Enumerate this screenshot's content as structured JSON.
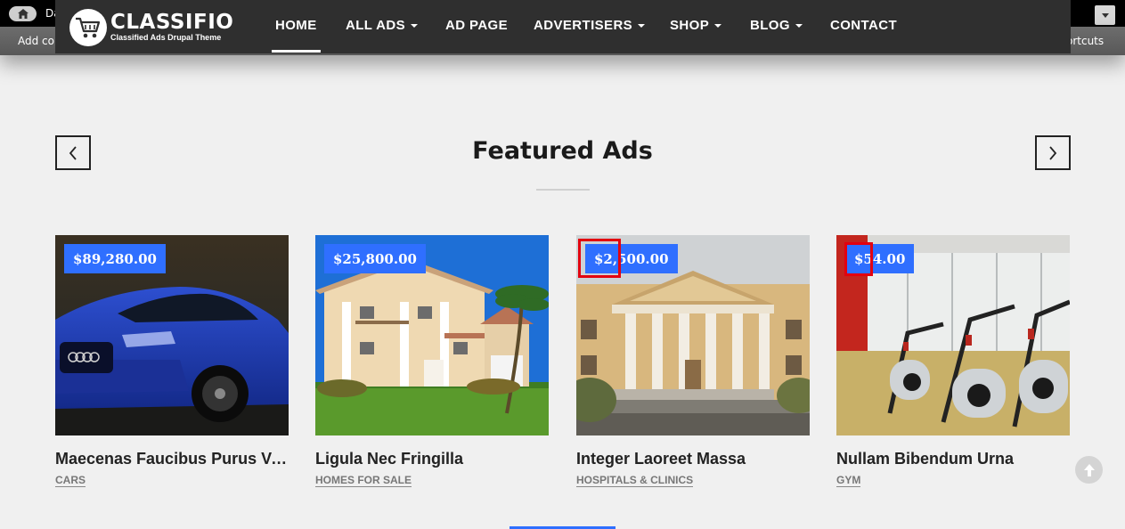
{
  "admin": {
    "tab_fragment": "Da",
    "shortcut_left_fragment": "Add co",
    "shortcut_right_fragment": "ortcuts"
  },
  "brand": {
    "name": "CLASSIFIO",
    "tagline": "Classified Ads Drupal Theme"
  },
  "nav": {
    "items": [
      {
        "label": "HOME"
      },
      {
        "label": "ALL ADS"
      },
      {
        "label": "AD PAGE"
      },
      {
        "label": "ADVERTISERS"
      },
      {
        "label": "SHOP"
      },
      {
        "label": "BLOG"
      },
      {
        "label": "CONTACT"
      }
    ]
  },
  "section": {
    "title": "Featured Ads"
  },
  "cards": [
    {
      "price": "$89,280.00",
      "title": "Maecenas Faucibus Purus Ve...",
      "category": "CARS"
    },
    {
      "price": "$25,800.00",
      "title": "Ligula Nec Fringilla",
      "category": "HOMES FOR SALE"
    },
    {
      "price": "$2,500.00",
      "title": "Integer Laoreet Massa",
      "category": "HOSPITALS & CLINICS"
    },
    {
      "price": "$54.00",
      "title": "Nullam Bibendum Urna",
      "category": "GYM"
    }
  ],
  "colors": {
    "accent": "#2f6fff",
    "highlight": "#e3000f",
    "navbar": "#2f2f2f"
  }
}
